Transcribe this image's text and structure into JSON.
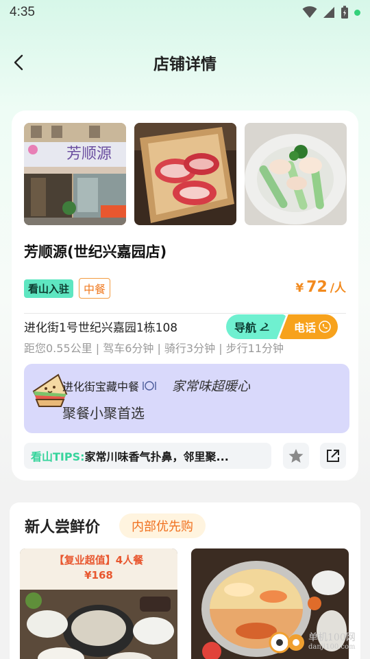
{
  "status_bar": {
    "time": "4:35"
  },
  "header": {
    "title": "店铺详情"
  },
  "store": {
    "name": "芳顺源(世纪兴嘉园店)",
    "photos": [
      "storefront-photo",
      "sliced-lamb-photo",
      "dish-photo"
    ],
    "signboard_text": "芳顺源",
    "tags": {
      "settled": "看山入驻",
      "cuisine": "中餐"
    },
    "price": {
      "symbol": "¥",
      "value": "72",
      "unit": "/人"
    },
    "address": "进化街1号世纪兴嘉园1栋108",
    "distance": "距您0.55公里 | 驾车6分钟 | 骑行3分钟 | 步行11分钟",
    "nav_label": "导航",
    "call_label": "电话"
  },
  "promo": {
    "line1": "进化街宝藏中餐",
    "slogan": "家常味超暖心",
    "line2": "聚餐小聚首选"
  },
  "tips": {
    "label": "看山TIPS:",
    "text": "家常川味香气扑鼻，邻里聚..."
  },
  "deals": {
    "title": "新人尝鲜价",
    "badge": "内部优先购",
    "items": [
      {
        "banner": "【复业超值】4人餐",
        "price": "¥168"
      },
      {
        "banner": "",
        "price": ""
      }
    ]
  },
  "watermark": {
    "text": "单机100网",
    "sub": "danji100.com"
  },
  "colors": {
    "accent_green": "#5ee6c1",
    "accent_orange": "#f7a21c",
    "price_orange": "#f28a1e",
    "promo_bg": "#d9d9fb"
  }
}
